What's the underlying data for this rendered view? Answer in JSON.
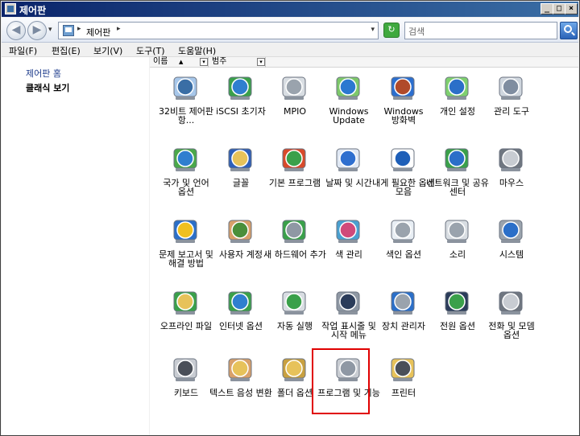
{
  "window": {
    "title": "제어판"
  },
  "caption_buttons": {
    "minimize": "_",
    "maximize": "□",
    "close": "×"
  },
  "nav": {
    "back_glyph": "◀",
    "forward_glyph": "▶",
    "dropdown_glyph": "▾"
  },
  "address": {
    "arrow": "▸",
    "path": "제어판",
    "path_arrow": "▸",
    "dropdown": "▾",
    "refresh_glyph": "↻"
  },
  "search": {
    "placeholder": "검색"
  },
  "menu": [
    "파일(F)",
    "편집(E)",
    "보기(V)",
    "도구(T)",
    "도움말(H)"
  ],
  "sidebar": {
    "links": [
      "제어판 홈",
      "클래식 보기"
    ],
    "active_index": 1
  },
  "columns": [
    {
      "label": "이름",
      "sort": "▲",
      "drop": "▾"
    },
    {
      "label": "범주",
      "drop": "▾"
    }
  ],
  "items": [
    {
      "label": "32비트 제어판 항...",
      "icon": "control-panel-32bit-icon",
      "colors": [
        "#3a6ea5",
        "#a7c7ea"
      ]
    },
    {
      "label": "iSCSI 초기자",
      "icon": "iscsi-initiator-icon",
      "colors": [
        "#2f7fcf",
        "#3aa04a"
      ]
    },
    {
      "label": "MPIO",
      "icon": "mpio-icon",
      "colors": [
        "#9aa3ad",
        "#d8dde2"
      ]
    },
    {
      "label": "Windows Update",
      "icon": "windows-update-icon",
      "colors": [
        "#2b78d0",
        "#7dc86a"
      ]
    },
    {
      "label": "Windows 방화벽",
      "icon": "windows-firewall-icon",
      "colors": [
        "#b04a2a",
        "#2c6fcf"
      ]
    },
    {
      "label": "개인 설정",
      "icon": "personalization-icon",
      "colors": [
        "#2b6fc8",
        "#7fd06f"
      ]
    },
    {
      "label": "관리 도구",
      "icon": "admin-tools-icon",
      "colors": [
        "#7f8da0",
        "#cfd6de"
      ]
    },
    {
      "label": "국가 및 언어 옵션",
      "icon": "region-language-icon",
      "colors": [
        "#2f7fcf",
        "#4aa84a"
      ]
    },
    {
      "label": "글꼴",
      "icon": "fonts-folder-icon",
      "colors": [
        "#e7c25a",
        "#2e5fb8"
      ]
    },
    {
      "label": "기본 프로그램",
      "icon": "default-programs-icon",
      "colors": [
        "#3aa04a",
        "#d84a2a"
      ]
    },
    {
      "label": "날짜 및 시간",
      "icon": "date-time-icon",
      "colors": [
        "#2f6fcf",
        "#e0e8f4"
      ]
    },
    {
      "label": "내게 필요한 옵션 모음",
      "icon": "ease-of-access-icon",
      "colors": [
        "#1e5fb8",
        "#ffffff"
      ]
    },
    {
      "label": "네트워크 및 공유 센터",
      "icon": "network-sharing-icon",
      "colors": [
        "#2b6fc8",
        "#3aa04a"
      ]
    },
    {
      "label": "마우스",
      "icon": "mouse-icon",
      "colors": [
        "#c8ccd2",
        "#6f7680"
      ]
    },
    {
      "label": "문제 보고서 및 해결 방법",
      "icon": "problem-reports-icon",
      "colors": [
        "#f0c020",
        "#2b6fc8"
      ]
    },
    {
      "label": "사용자 계정",
      "icon": "user-accounts-icon",
      "colors": [
        "#4a8f3a",
        "#d8a06a"
      ]
    },
    {
      "label": "새 하드웨어 추가",
      "icon": "add-hardware-icon",
      "colors": [
        "#8f98a4",
        "#3aa04a"
      ]
    },
    {
      "label": "색 관리",
      "icon": "color-management-icon",
      "colors": [
        "#d04a7a",
        "#4aa0d0"
      ]
    },
    {
      "label": "색인 옵션",
      "icon": "indexing-options-icon",
      "colors": [
        "#9aa3ad",
        "#e8eef4"
      ]
    },
    {
      "label": "소리",
      "icon": "sound-icon",
      "colors": [
        "#9aa3ad",
        "#d8dde2"
      ]
    },
    {
      "label": "시스템",
      "icon": "system-icon",
      "colors": [
        "#2b6fc8",
        "#9aa3ad"
      ]
    },
    {
      "label": "오프라인 파일",
      "icon": "offline-files-icon",
      "colors": [
        "#e7c25a",
        "#3aa04a"
      ]
    },
    {
      "label": "인터넷 옵션",
      "icon": "internet-options-icon",
      "colors": [
        "#2f7fcf",
        "#3aa04a"
      ]
    },
    {
      "label": "자동 실행",
      "icon": "autoplay-icon",
      "colors": [
        "#3aa04a",
        "#d8dde2"
      ]
    },
    {
      "label": "작업 표시줄 및 시작 메뉴",
      "icon": "taskbar-start-menu-icon",
      "colors": [
        "#2b3c5a",
        "#8f98a4"
      ]
    },
    {
      "label": "장치 관리자",
      "icon": "device-manager-icon",
      "colors": [
        "#9aa3ad",
        "#2b6fc8"
      ]
    },
    {
      "label": "전원 옵션",
      "icon": "power-options-icon",
      "colors": [
        "#3aa04a",
        "#2b3c5a"
      ]
    },
    {
      "label": "전화 및 모뎀 옵션",
      "icon": "phone-modem-icon",
      "colors": [
        "#c8ccd2",
        "#6f7680"
      ]
    },
    {
      "label": "키보드",
      "icon": "keyboard-icon",
      "colors": [
        "#4a4f58",
        "#c8ccd2"
      ]
    },
    {
      "label": "텍스트 음성 변환",
      "icon": "text-to-speech-icon",
      "colors": [
        "#e7c25a",
        "#d8a06a"
      ]
    },
    {
      "label": "폴더 옵션",
      "icon": "folder-options-icon",
      "colors": [
        "#e7c25a",
        "#c8a040"
      ]
    },
    {
      "label": "프로그램 및 기능",
      "icon": "programs-features-icon",
      "colors": [
        "#8f98a4",
        "#c8ccd2"
      ]
    },
    {
      "label": "프린터",
      "icon": "printer-icon",
      "colors": [
        "#4a4f58",
        "#e7c25a"
      ]
    }
  ],
  "highlight_color": "#e00000"
}
